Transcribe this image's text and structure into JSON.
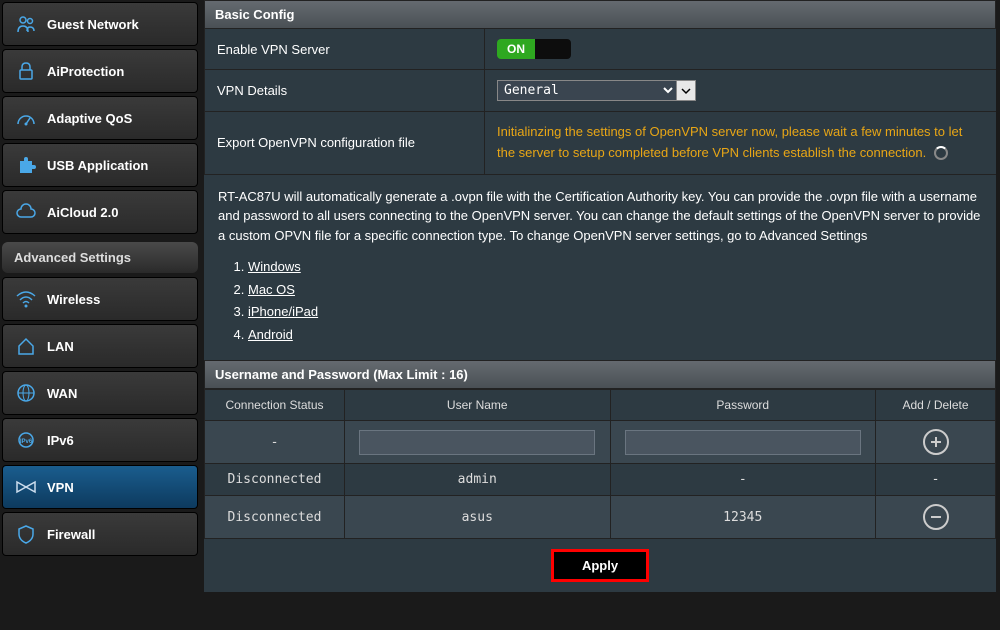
{
  "sidebar": {
    "items": [
      {
        "label": "Guest Network",
        "icon": "users"
      },
      {
        "label": "AiProtection",
        "icon": "lock"
      },
      {
        "label": "Adaptive QoS",
        "icon": "gauge"
      },
      {
        "label": "USB Application",
        "icon": "puzzle"
      },
      {
        "label": "AiCloud 2.0",
        "icon": "cloud"
      }
    ],
    "advanced_header": "Advanced Settings",
    "advanced": [
      {
        "label": "Wireless",
        "icon": "wifi"
      },
      {
        "label": "LAN",
        "icon": "home"
      },
      {
        "label": "WAN",
        "icon": "globe"
      },
      {
        "label": "IPv6",
        "icon": "ipv6"
      },
      {
        "label": "VPN",
        "icon": "vpn",
        "active": true
      },
      {
        "label": "Firewall",
        "icon": "shield"
      }
    ]
  },
  "basic_config": {
    "header": "Basic Config",
    "enable_label": "Enable VPN Server",
    "enable_on": "ON",
    "details_label": "VPN Details",
    "details_value": "General",
    "export_label": "Export OpenVPN configuration file",
    "export_status": "Initialinzing the settings of OpenVPN server now, please wait a few minutes to let the server to setup completed before VPN clients establish the connection."
  },
  "description": {
    "text": "RT-AC87U will automatically generate a .ovpn file with the Certification Authority key. You can provide the .ovpn file with a username and password to all users connecting to the OpenVPN server. You can change the default settings of the OpenVPN server to provide a custom OPVN file for a specific connection type. To change OpenVPN server settings, go to Advanced Settings",
    "links": [
      "Windows",
      "Mac OS",
      "iPhone/iPad",
      "Android"
    ]
  },
  "user_table": {
    "header": "Username and Password (Max Limit : 16)",
    "cols": {
      "status": "Connection Status",
      "user": "User Name",
      "pass": "Password",
      "action": "Add / Delete"
    },
    "input_row": {
      "status": "-"
    },
    "rows": [
      {
        "status": "Disconnected",
        "user": "admin",
        "pass": "-",
        "action": "-"
      },
      {
        "status": "Disconnected",
        "user": "asus",
        "pass": "12345",
        "action": "remove"
      }
    ]
  },
  "apply_label": "Apply"
}
